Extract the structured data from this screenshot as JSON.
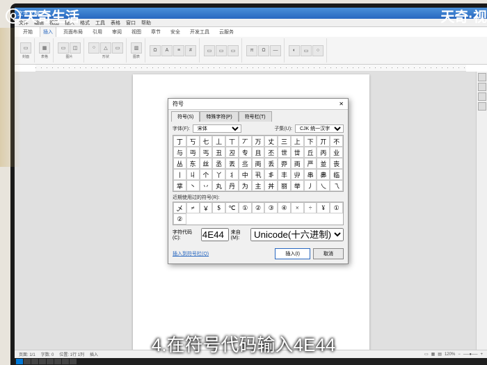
{
  "watermark": {
    "top_left": "天奇生活",
    "top_right": "天奇·视"
  },
  "subtitle": "4.在符号代码输入4E44",
  "app": {
    "title": "文字文稿"
  },
  "menu": [
    "文件",
    "编辑",
    "视图",
    "插入",
    "格式",
    "工具",
    "表格",
    "窗口",
    "帮助"
  ],
  "ribbon_tabs": [
    "开始",
    "插入",
    "页面布局",
    "引用",
    "审阅",
    "视图",
    "章节",
    "安全",
    "开发工具",
    "云服务"
  ],
  "ribbon_active": "插入",
  "ribbon_groups": [
    {
      "label": "封面",
      "icons": [
        "▭"
      ]
    },
    {
      "label": "表格",
      "icons": [
        "▦"
      ]
    },
    {
      "label": "图片",
      "icons": [
        "▭",
        "◫"
      ]
    },
    {
      "label": "形状",
      "icons": [
        "○",
        "△",
        "▭"
      ]
    },
    {
      "label": "图表",
      "icons": [
        "▥"
      ]
    },
    {
      "label": "",
      "icons": [
        "Ω",
        "A",
        "≡",
        "#"
      ]
    },
    {
      "label": "",
      "icons": [
        "▭",
        "▭",
        "▭"
      ]
    },
    {
      "label": "",
      "icons": [
        "π",
        "Ω",
        "—"
      ]
    },
    {
      "label": "",
      "icons": [
        "◐",
        "▭",
        "○"
      ]
    }
  ],
  "dialog": {
    "title": "符号",
    "tabs": [
      "符号(S)",
      "特殊字符(P)",
      "符号栏(T)"
    ],
    "font_label": "字体(F):",
    "font_value": "宋体",
    "subset_label": "子集(U):",
    "subset_value": "CJK 统一汉字",
    "chars": [
      "丁",
      "丂",
      "七",
      "丄",
      "丅",
      "丆",
      "万",
      "丈",
      "三",
      "上",
      "下",
      "丌",
      "不",
      "与",
      "丏",
      "丐",
      "丑",
      "丒",
      "专",
      "且",
      "丕",
      "世",
      "丗",
      "丘",
      "丙",
      "业",
      "丛",
      "东",
      "丝",
      "丞",
      "丟",
      "丠",
      "両",
      "丢",
      "丣",
      "両",
      "严",
      "並",
      "丧",
      "丨",
      "丩",
      "个",
      "丫",
      "丬",
      "中",
      "丮",
      "丯",
      "丰",
      "丱",
      "串",
      "丳",
      "临",
      "丵",
      "丶",
      "丷",
      "丸",
      "丹",
      "为",
      "主",
      "丼",
      "丽",
      "举",
      "丿",
      "乀",
      "乁"
    ],
    "recent_label": "近期使用过的符号(R):",
    "recent": [
      "乄",
      "≠",
      "￥",
      "$",
      "℃",
      "①",
      "②",
      "③",
      "④",
      "×",
      "÷",
      "¥",
      "①",
      "②"
    ],
    "code_label": "字符代码(C):",
    "code_value": "4E44",
    "from_label": "来自(M):",
    "from_value": "Unicode(十六进制)",
    "shortcut_link": "插入到符号栏(Q)",
    "insert_btn": "插入(I)",
    "cancel_btn": "取消"
  },
  "status": {
    "page": "页面: 1/1",
    "words": "字数: 0",
    "pos": "位置: 1行 1列",
    "mode": "插入",
    "zoom": "120%"
  },
  "close_x": "✕"
}
